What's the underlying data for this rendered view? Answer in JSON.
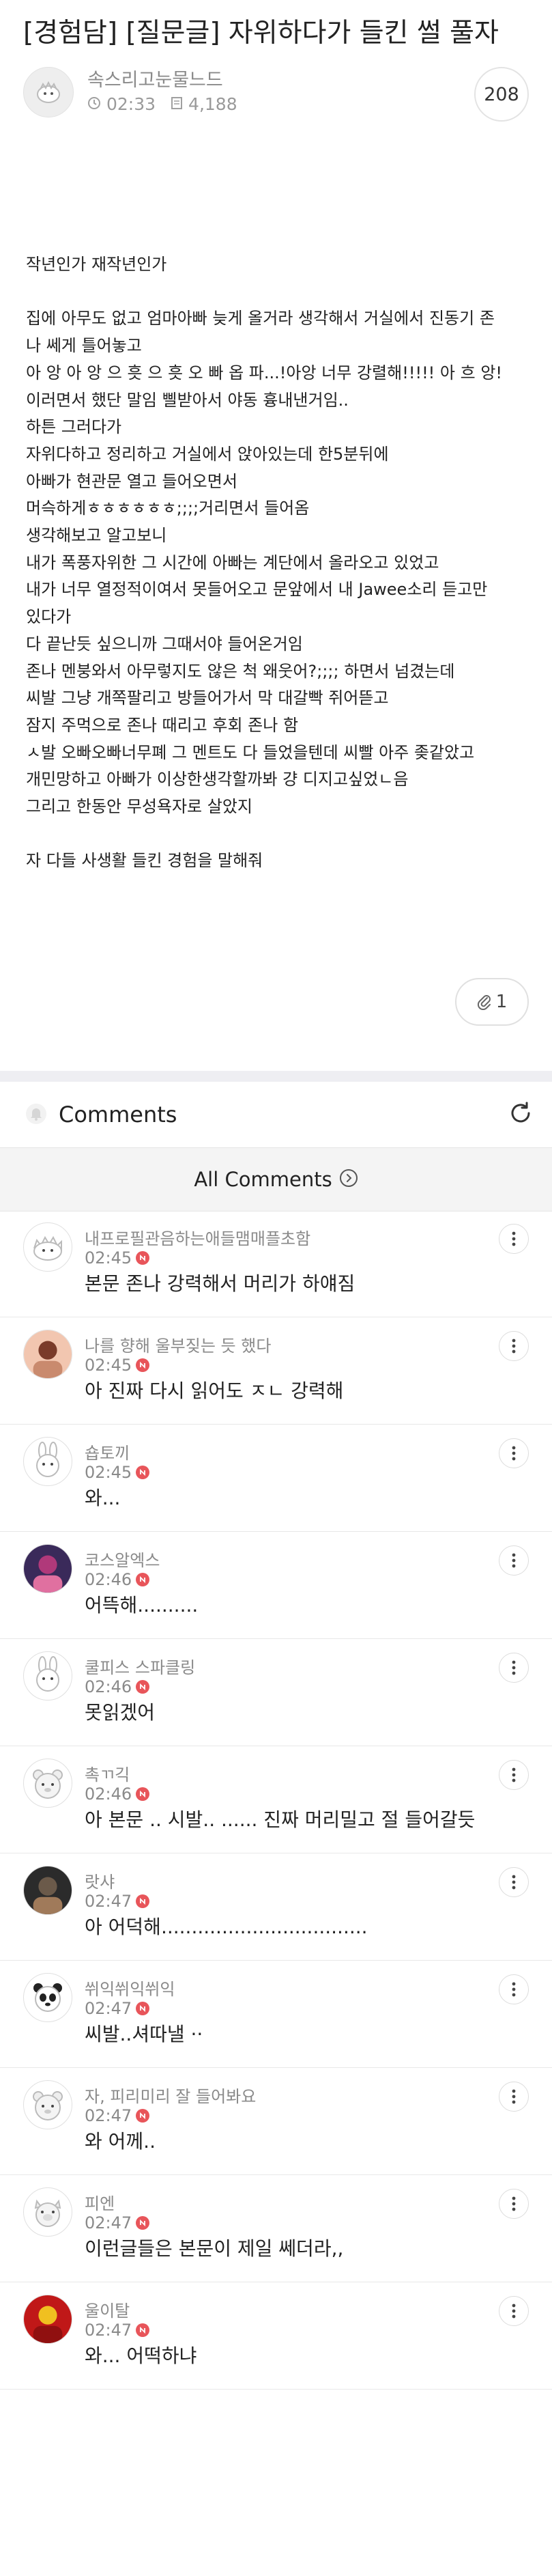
{
  "post": {
    "title": "[경험담] [질문글] 자위하다가 들킨 썰 풀자",
    "author": "속스리고눈물느드",
    "time": "02:33",
    "views": "4,188",
    "comment_count": "208",
    "body": [
      "작년인가 재작년인가",
      "",
      "집에 아무도 없고 엄마아빠 늦게 올거라 생각해서 거실에서 진동기 존",
      "나 쎄게 틀어놓고",
      "아 앙 아 앙 으 흣 으 흣 오 빠 옵 파...!아앙 너무 강렬해!!!!! 아 흐 앙!",
      "이러면서 했단 말임 삘받아서 야동 흉내낸거임..",
      "하튼 그러다가",
      "자위다하고 정리하고 거실에서 앉아있는데 한5분뒤에",
      "아빠가 현관문 열고 들어오면서",
      "머슥하게ㅎㅎㅎㅎㅎㅎ;;;;거리면서 들어옴",
      "생각해보고 알고보니",
      "내가 폭풍자위한 그 시간에 아빠는 계단에서 올라오고 있었고",
      "내가 너무 열정적이여서 못들어오고 문앞에서 내 Jawee소리 듣고만",
      "있다가",
      "다 끝난듯 싶으니까 그때서야 들어온거임",
      "존나 멘붕와서 아무렇지도 않은 척 왜웃어?;;;; 하면서 넘겼는데",
      "씨발 그냥 개쪽팔리고 방들어가서 막 대갈빡 쥐어뜯고",
      "잠지 주먹으로 존나 때리고 후회 존나 함",
      "ㅅ발 오빠오빠너무폐 그 멘트도 다 들었을텐데 씨빨 아주 좆같았고",
      "개민망하고 아빠가 이상한생각할까봐 걍 디지고싶었ㄴ음",
      "그리고 한동안 무성욕자로 살았지",
      "",
      "자 다들 사생활 들킨 경험을 말해줘"
    ],
    "attachment_count": "1"
  },
  "comments_section": {
    "label": "Comments",
    "all_comments_label": "All Comments"
  },
  "comments": [
    {
      "nick": "내프로필관음하는애들맴매플초함",
      "time": "02:45",
      "text": "본문 존나 강력해서 머리가 하얘짐",
      "avatar": "hedgehog-avatar-icon"
    },
    {
      "nick": "나를 향해 울부짖는 듯 했다",
      "time": "02:45",
      "text": "아 진짜 다시 읽어도 ㅈㄴ 강력해",
      "avatar": "photo-avatar"
    },
    {
      "nick": "숍토끼",
      "time": "02:45",
      "text": "와...",
      "avatar": "rabbit-avatar-icon"
    },
    {
      "nick": "코스알엑스",
      "time": "02:46",
      "text": "어뜩해..........",
      "avatar": "photo-avatar"
    },
    {
      "nick": "쿨피스 스파클링",
      "time": "02:46",
      "text": "못읽겠어",
      "avatar": "rabbit-avatar-icon"
    },
    {
      "nick": "촉ㄲ긱",
      "time": "02:46",
      "text": "아 본문 .. 시발.. ...... 진짜 머리밀고 절 들어갈듯",
      "avatar": "bear-avatar-icon"
    },
    {
      "nick": "랏샤",
      "time": "02:47",
      "text": "아 어덕해..................................",
      "avatar": "photo-avatar"
    },
    {
      "nick": "쒸익쒸익쒸익",
      "time": "02:47",
      "text": "씨발..셔따낼 ··",
      "avatar": "panda-avatar-icon"
    },
    {
      "nick": "자, 피리미리 잘 들어봐요",
      "time": "02:47",
      "text": "와 어께..",
      "avatar": "bear-avatar-icon"
    },
    {
      "nick": "피엔",
      "time": "02:47",
      "text": "이런글들은 본문이 제일 쎄더라,,",
      "avatar": "pig-avatar-icon"
    },
    {
      "nick": "울이탈",
      "time": "02:47",
      "text": "와... 어떡하냐",
      "avatar": "photo-avatar"
    }
  ],
  "colors": {
    "new_badge": "#e8555a",
    "divider": "#eeeef2",
    "muted_text": "#8a8a8a"
  },
  "icons": [
    "clock-icon",
    "document-icon",
    "paperclip-icon",
    "bell-icon",
    "refresh-icon",
    "chevron-right-circle-icon",
    "more-vertical-icon"
  ]
}
